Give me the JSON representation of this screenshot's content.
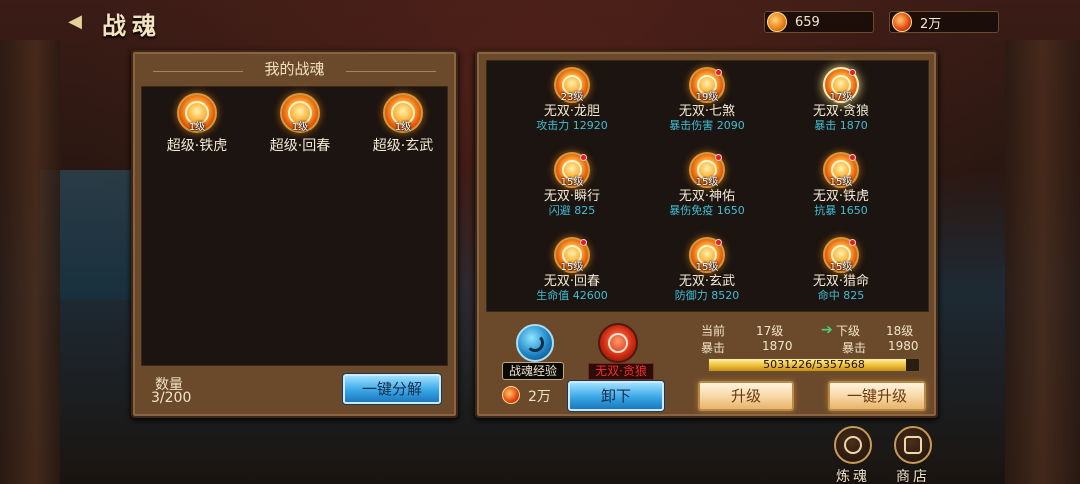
{
  "header": {
    "title": "战魂",
    "back_icon": "back-arrow-icon",
    "currencies": [
      {
        "icon": "coin-icon",
        "value": "659"
      },
      {
        "icon": "soul-essence-icon",
        "value": "2万"
      }
    ]
  },
  "my_souls": {
    "title": "我的战魂",
    "items": [
      {
        "level": "1级",
        "name": "超级·铁虎"
      },
      {
        "level": "1级",
        "name": "超级·回春"
      },
      {
        "level": "1级",
        "name": "超级·玄武"
      }
    ],
    "count_label": "数量",
    "count_value": "3/200",
    "decompose_label": "一键分解"
  },
  "equipped": {
    "items": [
      {
        "level": "23级",
        "name": "无双·龙胆",
        "stat": "攻击力 12920",
        "dot": false
      },
      {
        "level": "19级",
        "name": "无双·七煞",
        "stat": "暴击伤害 2090",
        "dot": true
      },
      {
        "level": "17级",
        "name": "无双·贪狼",
        "stat": "暴击 1870",
        "dot": true
      },
      {
        "level": "15级",
        "name": "无双·瞬行",
        "stat": "闪避 825",
        "dot": true
      },
      {
        "level": "15级",
        "name": "无双·神佑",
        "stat": "暴伤免疫 1650",
        "dot": true
      },
      {
        "level": "15级",
        "name": "无双·铁虎",
        "stat": "抗暴 1650",
        "dot": true
      },
      {
        "level": "15级",
        "name": "无双·回春",
        "stat": "生命值 42600",
        "dot": true
      },
      {
        "level": "15级",
        "name": "无双·玄武",
        "stat": "防御力 8520",
        "dot": true
      },
      {
        "level": "15级",
        "name": "无双·猎命",
        "stat": "命中 825",
        "dot": true
      }
    ]
  },
  "detail": {
    "exp_label": "战魂经验",
    "selected_name": "无双·贪狼",
    "cost_value": "2万",
    "unequip_label": "卸下",
    "current_label": "当前",
    "current_level": "17级",
    "next_label": "下级",
    "next_level": "18级",
    "stat_name": "暴击",
    "current_stat": "1870",
    "next_stat_name": "暴击",
    "next_stat": "1980",
    "exp_text": "5031226/5357568",
    "exp_progress": 0.94,
    "upgrade_label": "升级",
    "upgrade_all_label": "一键升级"
  },
  "side": {
    "refine_label": "炼魂",
    "shop_label": "商店"
  }
}
